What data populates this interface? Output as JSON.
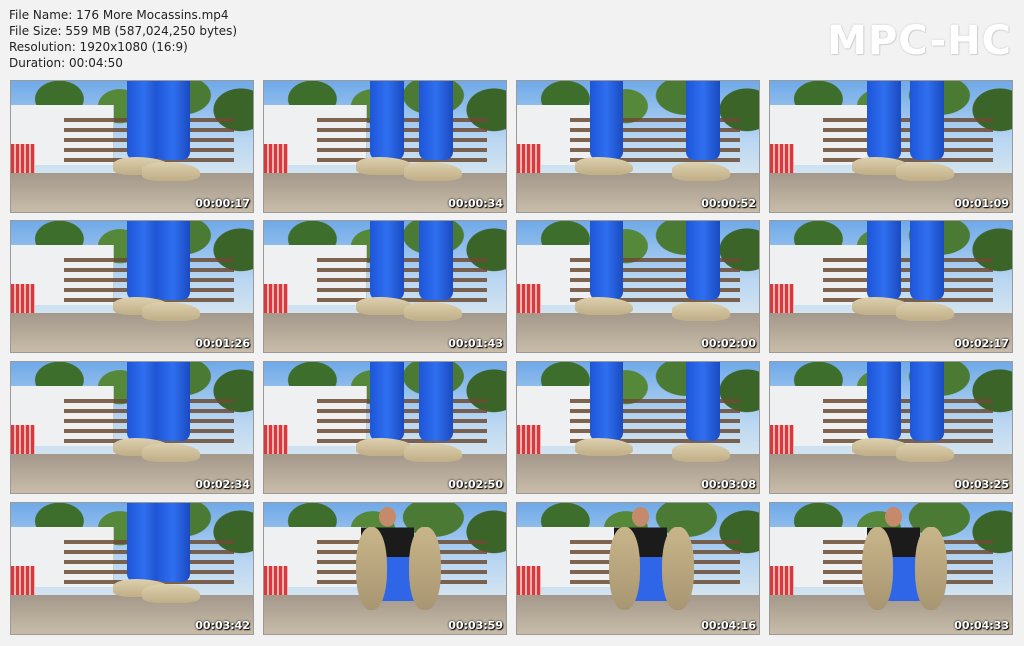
{
  "file_info": {
    "name": "File Name: 176 More Mocassins.mp4",
    "size": "File Size: 559 MB (587,024,250 bytes)",
    "resolution": "Resolution: 1920x1080 (16:9)",
    "duration": "Duration: 00:04:50"
  },
  "logo": "MPC-HC",
  "thumbnails": [
    {
      "timestamp": "00:00:17",
      "scene": "legs"
    },
    {
      "timestamp": "00:00:34",
      "scene": "legs"
    },
    {
      "timestamp": "00:00:52",
      "scene": "legs"
    },
    {
      "timestamp": "00:01:09",
      "scene": "legs"
    },
    {
      "timestamp": "00:01:26",
      "scene": "legs"
    },
    {
      "timestamp": "00:01:43",
      "scene": "legs"
    },
    {
      "timestamp": "00:02:00",
      "scene": "legs"
    },
    {
      "timestamp": "00:02:17",
      "scene": "legs"
    },
    {
      "timestamp": "00:02:34",
      "scene": "legs"
    },
    {
      "timestamp": "00:02:50",
      "scene": "legs"
    },
    {
      "timestamp": "00:03:08",
      "scene": "legs"
    },
    {
      "timestamp": "00:03:25",
      "scene": "legs"
    },
    {
      "timestamp": "00:03:42",
      "scene": "legs"
    },
    {
      "timestamp": "00:03:59",
      "scene": "soles"
    },
    {
      "timestamp": "00:04:16",
      "scene": "soles"
    },
    {
      "timestamp": "00:04:33",
      "scene": "soles"
    }
  ]
}
